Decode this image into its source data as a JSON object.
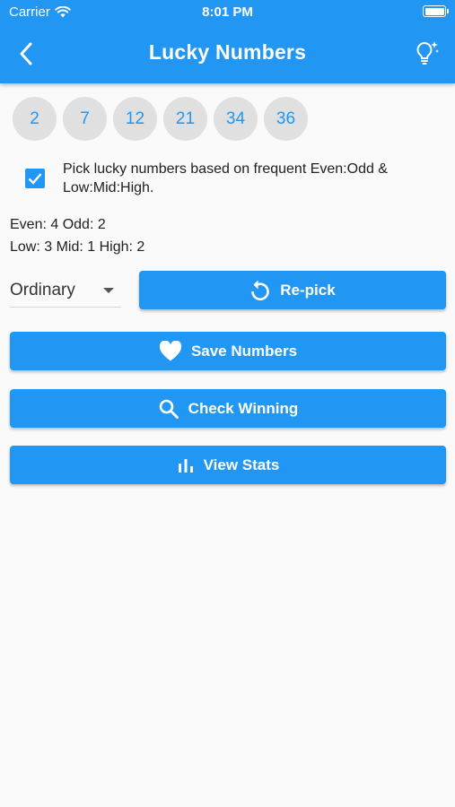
{
  "status_bar": {
    "carrier": "Carrier",
    "time": "8:01 PM"
  },
  "appbar": {
    "title": "Lucky Numbers"
  },
  "numbers": [
    "2",
    "7",
    "12",
    "21",
    "34",
    "36"
  ],
  "option": {
    "checked": true,
    "label": "Pick lucky numbers based on frequent Even:Odd & Low:Mid:High."
  },
  "stats": {
    "even_odd": "Even: 4 Odd: 2",
    "low_mid_high": "Low: 3 Mid: 1 High: 2"
  },
  "dropdown": {
    "selected": "Ordinary"
  },
  "buttons": {
    "repick": "Re-pick",
    "save": "Save Numbers",
    "check": "Check Winning",
    "stats": "View Stats"
  },
  "colors": {
    "primary": "#2196f3",
    "ball_bg": "#e0e0e0",
    "background": "#fafafa"
  },
  "icons": [
    "back-arrow-icon",
    "lightbulb-icon",
    "checkbox-check-icon",
    "dropdown-arrow-icon",
    "refresh-icon",
    "heart-icon",
    "search-icon",
    "bar-chart-icon",
    "wifi-icon",
    "battery-icon"
  ]
}
